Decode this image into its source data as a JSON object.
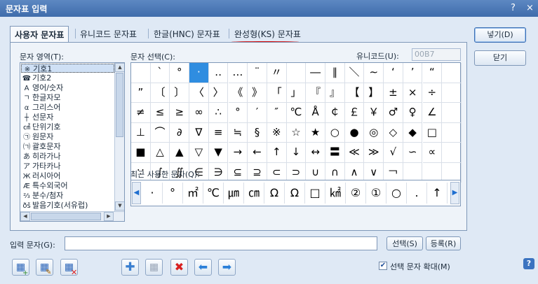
{
  "window": {
    "title": "문자표 입력",
    "help_glyph": "?",
    "close_glyph": "×"
  },
  "tabs": [
    {
      "label": "사용자 문자표",
      "active": true
    },
    {
      "label": "유니코드 문자표",
      "active": false
    },
    {
      "label": "한글(HNC) 문자표",
      "active": false
    },
    {
      "label": "완성형(KS) 문자표",
      "active": false
    }
  ],
  "area_label": "문자 영역(T):",
  "select_label": "문자 선택(C):",
  "unicode_label": "유니코드(U):",
  "unicode_value": "00B7",
  "recent_label": "최근 사용한 문자(Q):",
  "input_label": "입력 문자(G):",
  "input_value": "",
  "categories": [
    {
      "icon": "※",
      "label": "기호1",
      "selected": true
    },
    {
      "icon": "☎",
      "label": "기호2",
      "selected": false
    },
    {
      "icon": "A",
      "label": "영어/숫자",
      "selected": false
    },
    {
      "icon": "ㄱ",
      "label": "한글자모",
      "selected": false
    },
    {
      "icon": "α",
      "label": "그리스어",
      "selected": false
    },
    {
      "icon": "┼",
      "label": "선문자",
      "selected": false
    },
    {
      "icon": "㎠",
      "label": "단위기호",
      "selected": false
    },
    {
      "icon": "㉠",
      "label": "원문자",
      "selected": false
    },
    {
      "icon": "㈀",
      "label": "괄호문자",
      "selected": false
    },
    {
      "icon": "あ",
      "label": "히라가나",
      "selected": false
    },
    {
      "icon": "ア",
      "label": "가타카나",
      "selected": false
    },
    {
      "icon": "Ж",
      "label": "러시아어",
      "selected": false
    },
    {
      "icon": "Æ",
      "label": "특수외국어",
      "selected": false
    },
    {
      "icon": "⅔",
      "label": "분수/첨자",
      "selected": false
    },
    {
      "icon": "ðš",
      "label": "발음기호(서유럽)",
      "selected": false
    }
  ],
  "symbol_grid": [
    [
      "",
      "ˋ",
      "°",
      "·",
      "‥",
      "…",
      "¨",
      "〃",
      "­",
      "―",
      "∥",
      "＼",
      "∼",
      "‘",
      "’",
      "“",
      ""
    ],
    [
      "”",
      "〔",
      "〕",
      "〈",
      "〉",
      "《",
      "》",
      "「",
      "」",
      "『",
      "』",
      "【",
      "】",
      "±",
      "×",
      "÷",
      ""
    ],
    [
      "≠",
      "≤",
      "≥",
      "∞",
      "∴",
      "°",
      "′",
      "″",
      "℃",
      "Å",
      "￠",
      "￡",
      "￥",
      "♂",
      "♀",
      "∠",
      ""
    ],
    [
      "⊥",
      "⌒",
      "∂",
      "∇",
      "≡",
      "≒",
      "§",
      "※",
      "☆",
      "★",
      "○",
      "●",
      "◎",
      "◇",
      "◆",
      "□",
      ""
    ],
    [
      "■",
      "△",
      "▲",
      "▽",
      "▼",
      "→",
      "←",
      "↑",
      "↓",
      "↔",
      "〓",
      "≪",
      "≫",
      "√",
      "∽",
      "∝",
      ""
    ],
    [
      "∵",
      "∫",
      "∬",
      "∈",
      "∋",
      "⊆",
      "⊇",
      "⊂",
      "⊃",
      "∪",
      "∩",
      "∧",
      "∨",
      "￢",
      "",
      "",
      ""
    ]
  ],
  "selected_symbol": "·",
  "recent_chars": [
    "·",
    "°",
    "㎡",
    "℃",
    "㎛",
    "㎝",
    "Ω",
    "Ω",
    "□",
    "㎢",
    "②",
    "①",
    "○",
    ".",
    "↑"
  ],
  "buttons": {
    "insert": "넣기(D)",
    "close": "닫기",
    "select": "선택(S)",
    "register": "등록(R)"
  },
  "enlarge_checkbox": {
    "label": "선택 문자 확대(M)",
    "checked": true
  },
  "toolbar": [
    "add-charset",
    "edit-charset",
    "delete-charset",
    "add-char",
    "insert-char",
    "delete-char",
    "move-left",
    "move-right"
  ]
}
